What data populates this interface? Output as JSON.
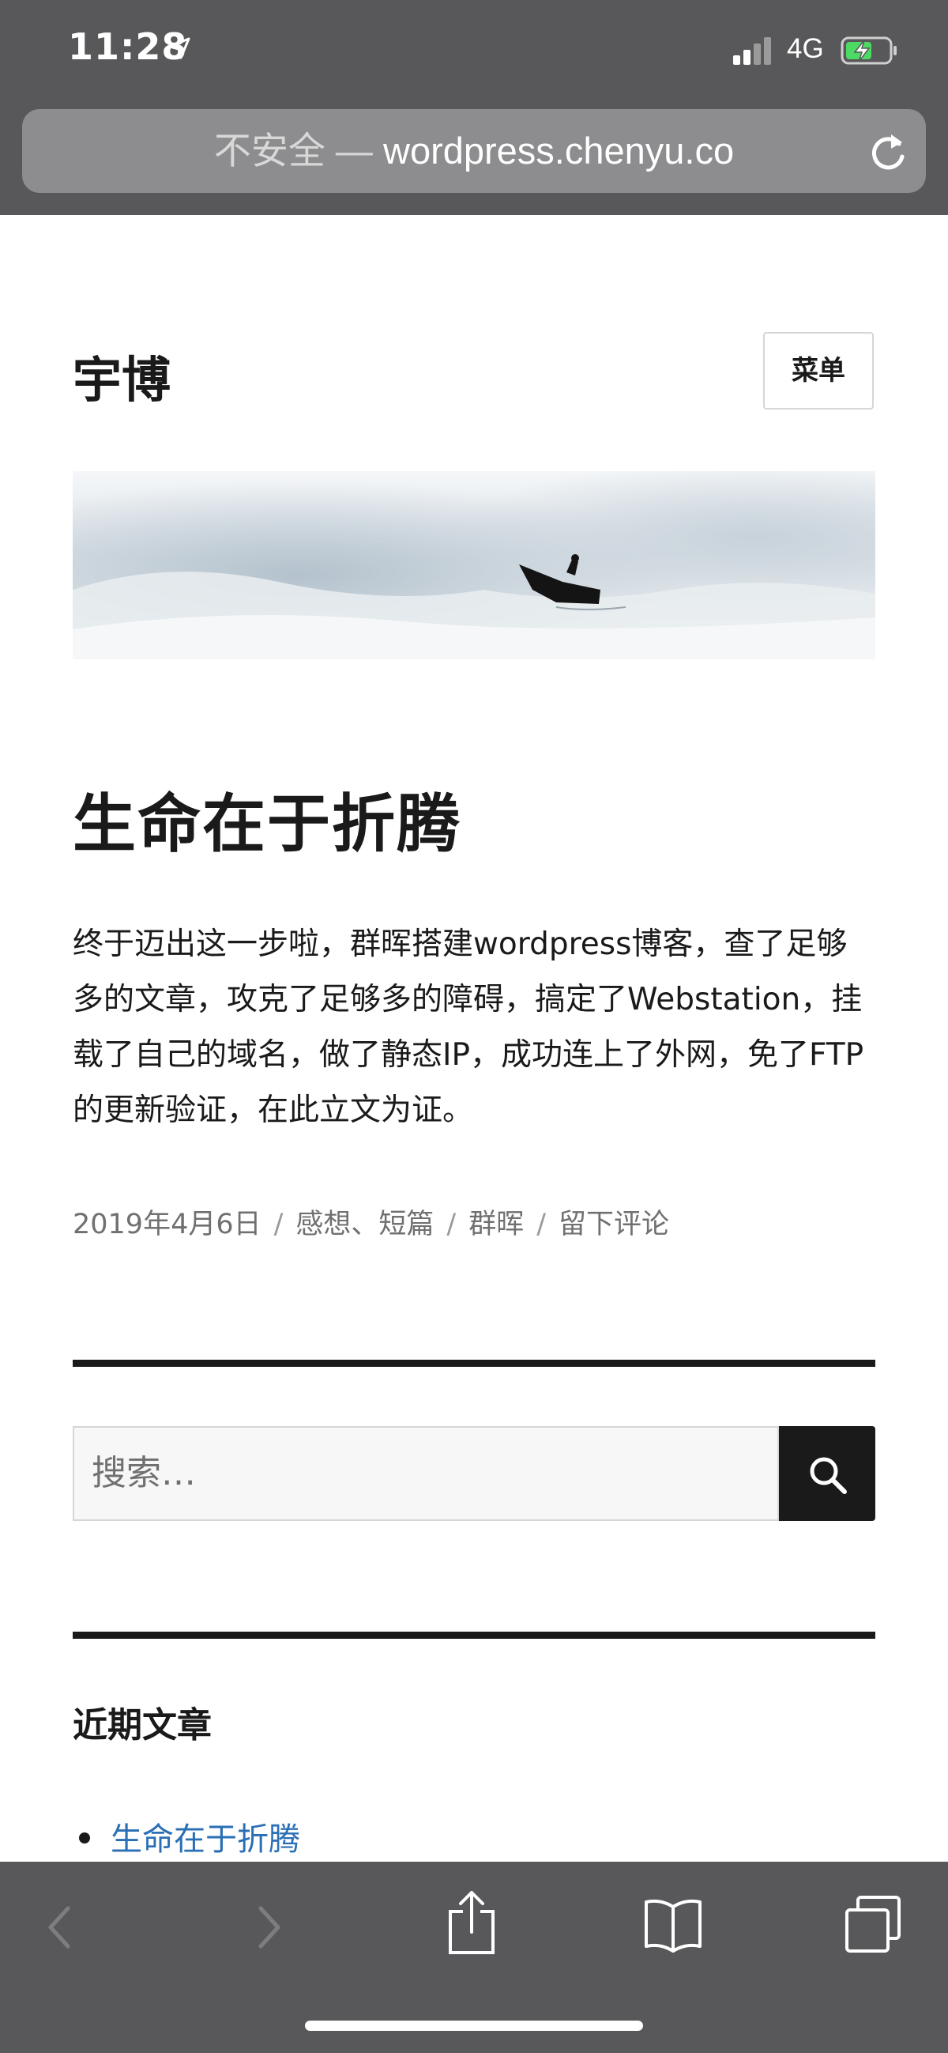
{
  "status": {
    "time": "11:28",
    "network": "4G"
  },
  "address_bar": {
    "insecure_label": "不安全",
    "separator": " — ",
    "domain": "wordpress.chenyu.co"
  },
  "site": {
    "title": "宇博",
    "menu_label": "菜单"
  },
  "post": {
    "title": "生命在于折腾",
    "body": "终于迈出这一步啦，群晖搭建wordpress博客，查了足够多的文章，攻克了足够多的障碍，搞定了Webstation，挂载了自己的域名，做了静态IP，成功连上了外网，免了FTP的更新验证，在此立文为证。",
    "meta": {
      "date": "2019年4月6日",
      "categories": "感想、短篇",
      "tag": "群晖",
      "comment_link": "留下评论",
      "separator": "/"
    }
  },
  "search": {
    "placeholder": "搜索…"
  },
  "recent_posts": {
    "heading": "近期文章",
    "items": [
      "生命在于折腾"
    ]
  },
  "colors": {
    "chrome": "#58585a",
    "link": "#2a6fb5",
    "text": "#1a1a1a",
    "meta": "#707070"
  }
}
